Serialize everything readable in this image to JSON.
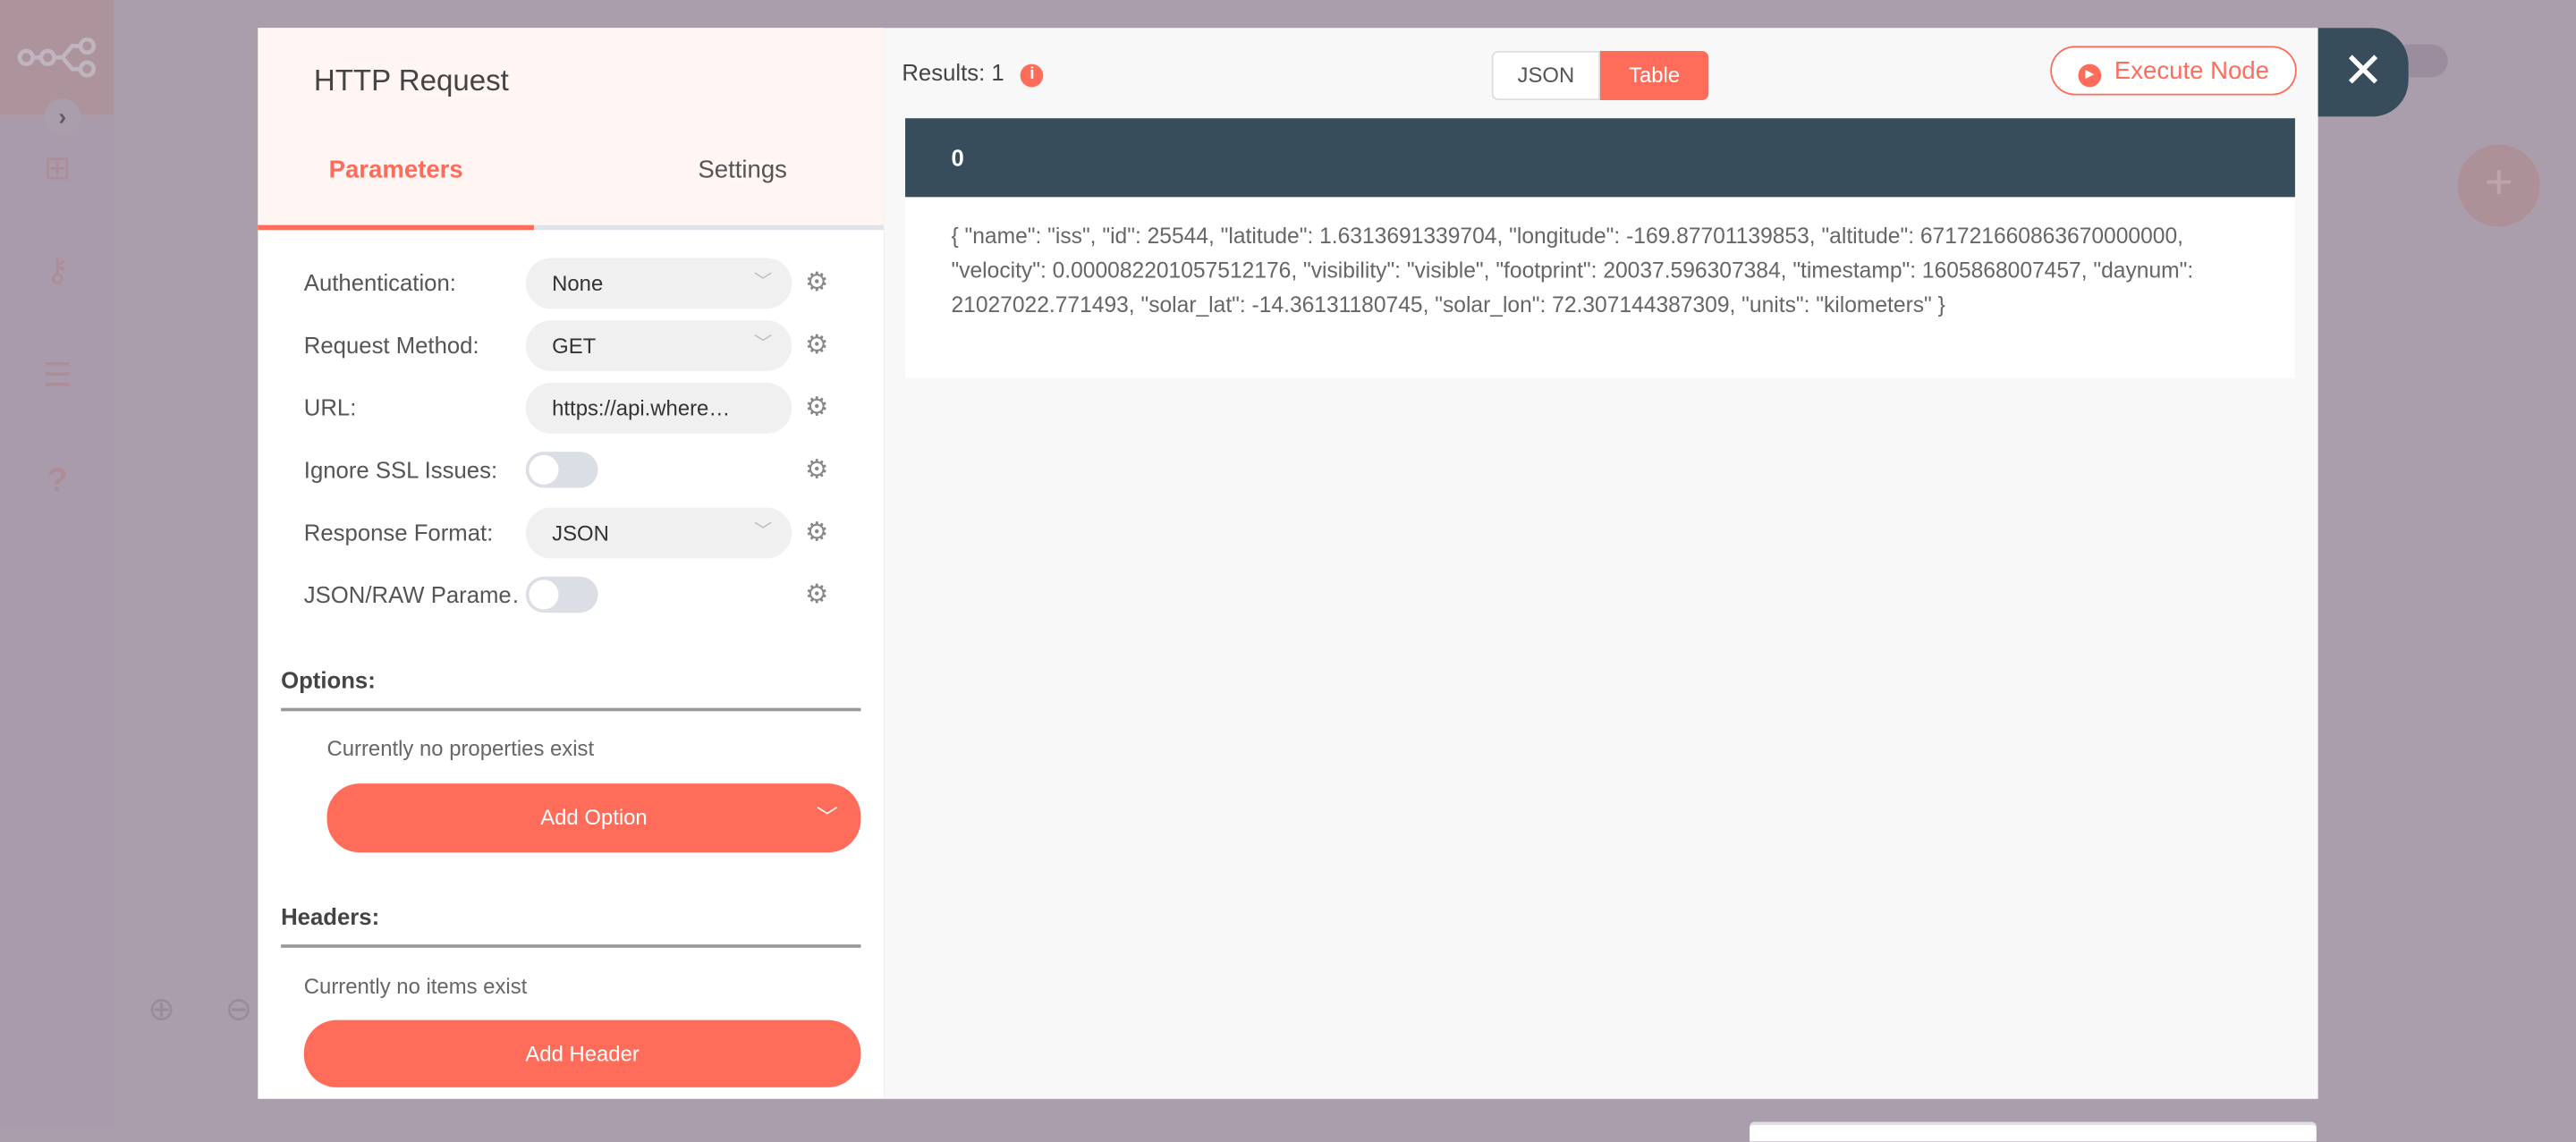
{
  "sidebar": {
    "icons": [
      "n8n-logo-icon",
      "chevron-right-icon",
      "network-icon",
      "key-icon",
      "checklist-icon",
      "question-icon"
    ]
  },
  "node": {
    "title": "HTTP Request",
    "tabs": [
      {
        "label": "Parameters",
        "active": true
      },
      {
        "label": "Settings",
        "active": false
      }
    ],
    "parameters": [
      {
        "label": "Authentication:",
        "type": "select",
        "value": "None"
      },
      {
        "label": "Request Method:",
        "type": "select",
        "value": "GET"
      },
      {
        "label": "URL:",
        "type": "input",
        "value": "https://api.where…"
      },
      {
        "label": "Ignore SSL Issues:",
        "type": "toggle",
        "value": false
      },
      {
        "label": "Response Format:",
        "type": "select",
        "value": "JSON"
      },
      {
        "label": "JSON/RAW Parame…",
        "type": "toggle",
        "value": false
      }
    ],
    "options": {
      "heading": "Options:",
      "empty": "Currently no properties exist",
      "button": "Add Option"
    },
    "headers": {
      "heading": "Headers:",
      "empty": "Currently no items exist",
      "button": "Add Header"
    }
  },
  "output": {
    "results_label": "Results: 1",
    "view_toggle": [
      {
        "label": "JSON",
        "active": false
      },
      {
        "label": "Table",
        "active": true
      }
    ],
    "execute_button": "Execute Node",
    "table": {
      "header": "0",
      "cell": "{ \"name\": \"iss\", \"id\": 25544, \"latitude\": 1.6313691339704, \"longitude\": -169.87701139853, \"altitude\": 671721660863670000000, \"velocity\": 0.000082201057512176, \"visibility\": \"visible\", \"footprint\": 20037.596307384, \"timestamp\": 1605868007457, \"daynum\": 21027022.771493, \"solar_lat\": -14.36131180745, \"solar_lon\": 72.307144387309, \"units\": \"kilometers\" }"
    }
  },
  "colors": {
    "accent": "#ff6d5a",
    "dark": "#384d5c",
    "overlay": "#ab9eac"
  }
}
